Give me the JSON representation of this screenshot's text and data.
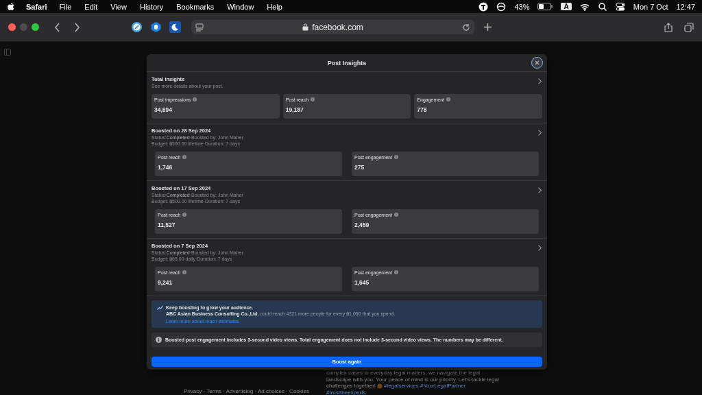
{
  "menu_bar": {
    "app_name": "Safari",
    "menus": [
      "File",
      "Edit",
      "View",
      "History",
      "Bookmarks",
      "Window",
      "Help"
    ],
    "battery_percent": "43%",
    "input_source": "A",
    "date": "Mon 7 Oct",
    "time": "12:47"
  },
  "toolbar": {
    "address": "facebook.com"
  },
  "background": {
    "post_lines": [
      "complex cases to everyday legal matters, we navigate the legal",
      "landscape with you. Your peace of mind is our priority. Let's tackle legal"
    ],
    "post_last_line": "challenges together!",
    "hashtags": "#legalservices #YourLegalPartner",
    "hashtags_2": "#trusttheexperts",
    "footer": "Privacy · Terms · Advertising · Ad choices · Cookies"
  },
  "modal": {
    "title": "Post Insights",
    "total": {
      "title": "Total insights",
      "subtitle": "See more details about your post.",
      "metrics": [
        {
          "label": "Post impressions",
          "value": "34,694"
        },
        {
          "label": "Post reach",
          "value": "19,187"
        },
        {
          "label": "Engagement",
          "value": "778"
        }
      ]
    },
    "boosts": [
      {
        "title": "Boosted on 28 Sep 2024",
        "status": "Status:**Completed**·Boosted by: John Maher",
        "budget": "Budget: ฿500.00 lifetime·Duration: 7 days",
        "metrics": [
          {
            "label": "Post reach",
            "value": "1,746"
          },
          {
            "label": "Post engagement",
            "value": "275"
          }
        ]
      },
      {
        "title": "Boosted on 17 Sep 2024",
        "status": "Status:**Completed**·Boosted by: John Maher",
        "budget": "Budget: ฿500.00 lifetime·Duration: 7 days",
        "metrics": [
          {
            "label": "Post reach",
            "value": "11,527"
          },
          {
            "label": "Post engagement",
            "value": "2,459"
          }
        ]
      },
      {
        "title": "Boosted on 7 Sep 2024",
        "status": "Status:**Completed**·Boosted by: John Maher",
        "budget": "Budget: ฿65.00 daily·Duration: 7 days",
        "metrics": [
          {
            "label": "Post reach",
            "value": "9,241"
          },
          {
            "label": "Post engagement",
            "value": "1,645"
          }
        ]
      }
    ],
    "promo": {
      "heading": "Keep boosting to grow your audience.",
      "text": "**ABC Asian Business Consulting Co.,Ltd.** could reach 4321 more people for every ฿1,050 that you spend.",
      "link": "Learn more about reach estimates"
    },
    "note": "Boosted post engagement includes 3-second video views. Total engagement does not include 3-second video views. The numbers may be different.",
    "button": "Boost again"
  }
}
